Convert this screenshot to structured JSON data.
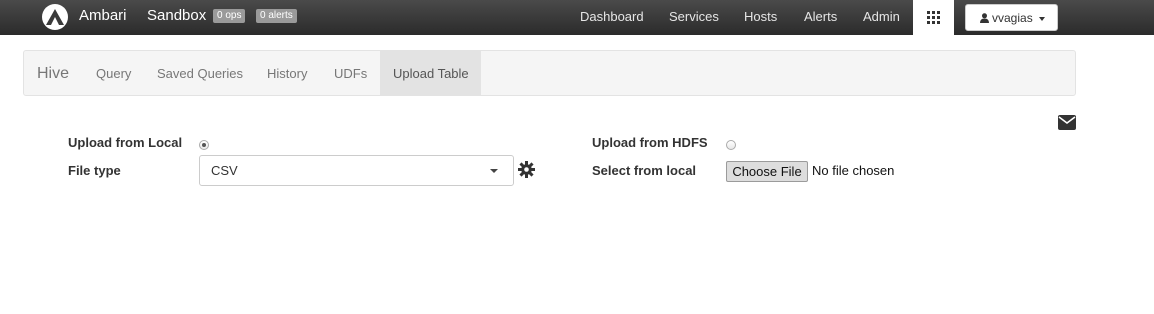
{
  "topbar": {
    "brand": "Ambari",
    "cluster_name": "Sandbox",
    "ops_badge": "0 ops",
    "alerts_badge": "0 alerts",
    "nav": [
      "Dashboard",
      "Services",
      "Hosts",
      "Alerts",
      "Admin"
    ],
    "apps_icon": "grid-icon",
    "user": "vvagias"
  },
  "subnav": {
    "title": "Hive",
    "items": [
      "Query",
      "Saved Queries",
      "History",
      "UDFs",
      "Upload Table"
    ],
    "active": "Upload Table"
  },
  "form": {
    "upload_local_label": "Upload from Local",
    "upload_local_selected": true,
    "upload_hdfs_label": "Upload from HDFS",
    "upload_hdfs_selected": false,
    "file_type_label": "File type",
    "file_type_value": "CSV",
    "select_local_label": "Select from local",
    "choose_file_button": "Choose File",
    "no_file_text": "No file chosen"
  },
  "icons": {
    "mail": "envelope-icon",
    "settings": "gear-icon",
    "user": "user-icon"
  },
  "colors": {
    "topbar": "#333333",
    "subnav_background": "#f5f5f5",
    "active_tab": "#e3e3e3"
  }
}
